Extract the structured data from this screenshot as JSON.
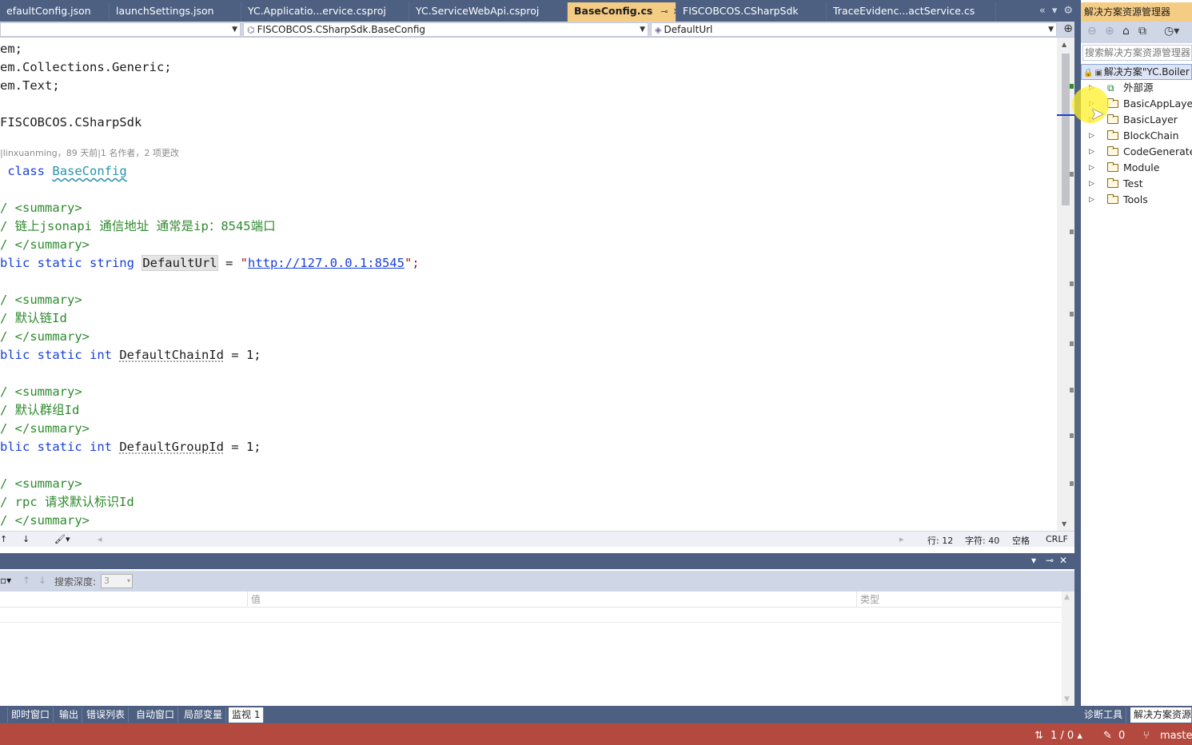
{
  "tabs": [
    {
      "label": "efaultConfig.json",
      "active": false
    },
    {
      "label": "launchSettings.json",
      "active": false
    },
    {
      "label": "YC.Applicatio...ervice.csproj",
      "active": false
    },
    {
      "label": "YC.ServiceWebApi.csproj",
      "active": false
    },
    {
      "label": "BaseConfig.cs",
      "active": true
    },
    {
      "label": "FISCOBCOS.CSharpSdk",
      "active": false
    },
    {
      "label": "TraceEvidenc...actService.cs",
      "active": false
    }
  ],
  "navbar": {
    "project": "",
    "type": "FISCOBCOS.CSharpSdk.BaseConfig",
    "member": "DefaultUrl"
  },
  "code": {
    "l1": "em;",
    "l2": "em.Collections.Generic;",
    "l3": "em.Text;",
    "ns": "FISCOBCOS.CSharpSdk",
    "codelens": "|linxuanming，89 天前|1 名作者，2 项更改",
    "class_kw": "class",
    "class_name": "BaseConfig",
    "sum_open": "/ <summary>",
    "sum_close": "/ </summary>",
    "c1": "/ 链上jsonapi 通信地址 通常是ip：8545端口",
    "url_prefix": "blic static string ",
    "url_name": "DefaultUrl",
    "url_eq": " = ",
    "url_q1": "\"",
    "url_value": "http://127.0.0.1:8545",
    "url_q2": "\";",
    "c2": "/ 默认链Id",
    "chain_prefix": "blic static int ",
    "chain_name": "DefaultChainId",
    "chain_rest": " = 1;",
    "c3": "/ 默认群组Id",
    "group_prefix": "blic static int ",
    "group_name": "DefaultGroupId",
    "group_rest": " = 1;",
    "c4": "/ rpc 请求默认标识Id"
  },
  "editor_status": {
    "line": "行: 12",
    "col": "字符: 40",
    "spaces": "空格",
    "eol": "CRLF"
  },
  "watch": {
    "depth_label": "搜索深度:",
    "depth_value": "3",
    "col_name": "",
    "col_value": "值",
    "col_type": "类型"
  },
  "bottom_tabs": [
    "即时窗口",
    "输出",
    "错误列表",
    "自动窗口",
    "局部变量",
    "监视 1"
  ],
  "solution_explorer": {
    "title": "解决方案资源管理器",
    "search_placeholder": "搜索解决方案资源管理器(",
    "root": "解决方案\"YC.Boiler",
    "items": [
      "外部源",
      "BasicAppLayer",
      "BasicLayer",
      "BlockChain",
      "CodeGenerate",
      "Module",
      "Test",
      "Tools"
    ],
    "bottom_tabs": [
      "诊断工具",
      "解决方案资源管"
    ]
  },
  "statusbar": {
    "sync": "1 / 0",
    "edits": "0",
    "branch": "master"
  },
  "icons": {
    "pin": "pin-icon",
    "close": "close-icon",
    "gear": "gear-icon",
    "home": "home-icon",
    "arrow_up": "arrow-up-icon",
    "arrow_down": "arrow-down-icon"
  },
  "colors": {
    "frame": "#4d6082",
    "active_tab": "#f5cc84",
    "statusbar": "#b44a3f"
  }
}
